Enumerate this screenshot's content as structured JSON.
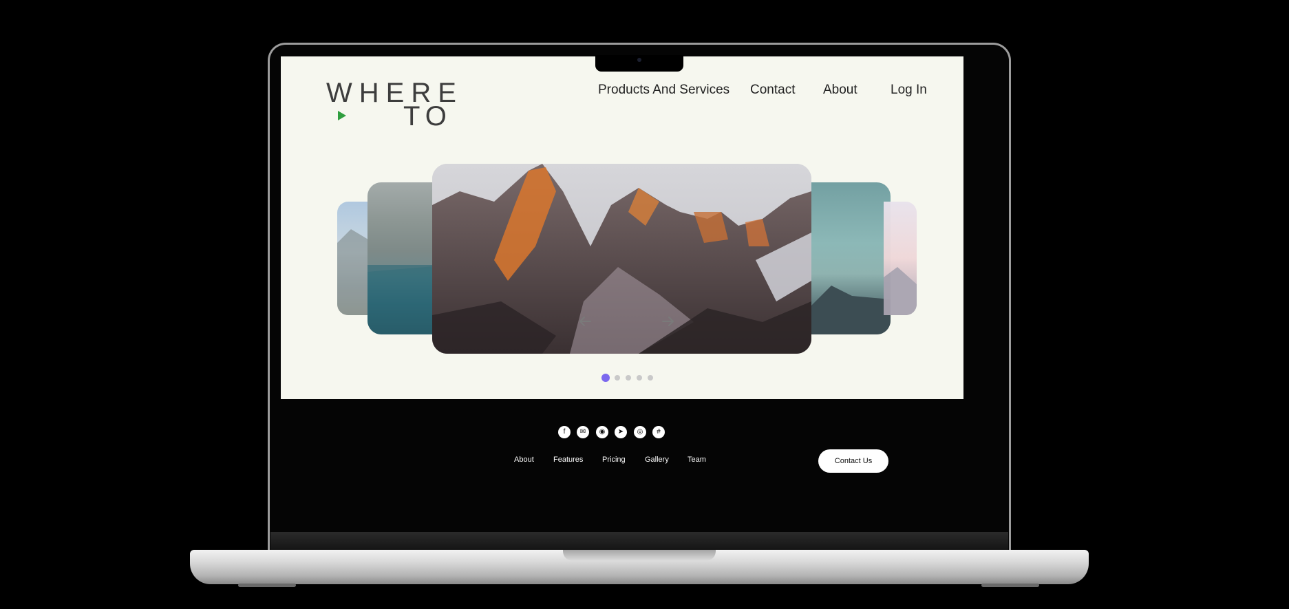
{
  "brand": {
    "line1": "WHERE",
    "line2": "TO",
    "accent_color": "#2f9e3e"
  },
  "nav": {
    "products": "Products And Services",
    "contact": "Contact",
    "about": "About",
    "login": "Log In"
  },
  "carousel": {
    "prev_icon": "arrow-left-icon",
    "next_icon": "arrow-right-icon",
    "slide_count": 5,
    "active_index": 0,
    "active_color": "#7b68ee"
  },
  "social": [
    "facebook-icon",
    "mail-icon",
    "github-icon",
    "telegram-icon",
    "instagram-icon",
    "web-icon"
  ],
  "footer": {
    "links": [
      "About",
      "Features",
      "Pricing",
      "Gallery",
      "Team"
    ],
    "cta": "Contact Us"
  }
}
